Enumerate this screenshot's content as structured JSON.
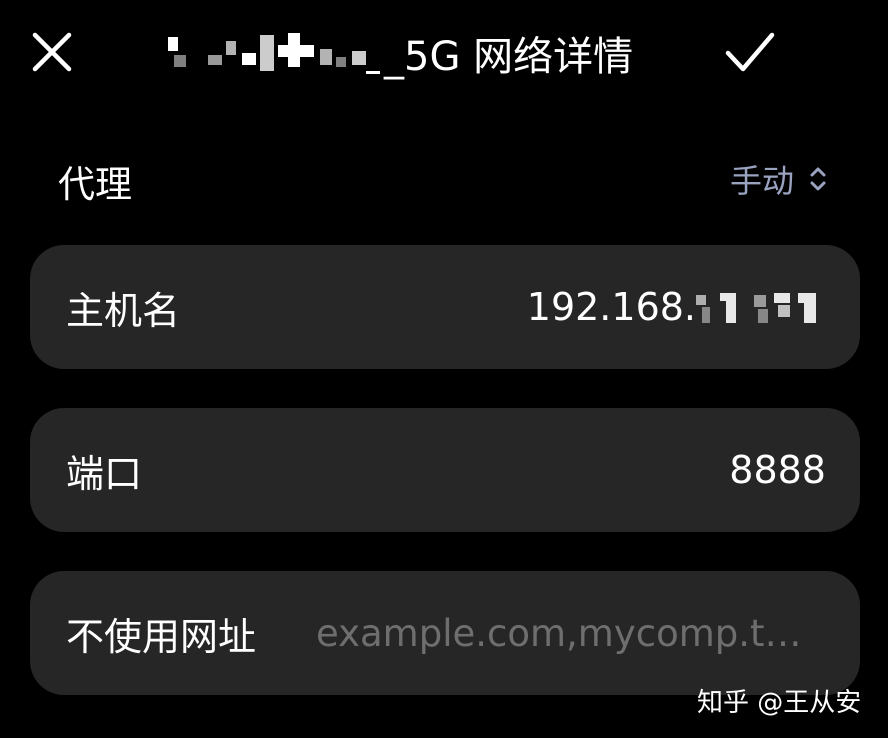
{
  "header": {
    "title_suffix": "_5G 网络详情",
    "close_icon": "close-icon",
    "confirm_icon": "checkmark-icon"
  },
  "proxy": {
    "label": "代理",
    "value": "手动",
    "value_color": "#9aa3c0",
    "value_icon": "chevron-up-down-icon"
  },
  "fields": {
    "hostname": {
      "label": "主机名",
      "value_prefix": "192.168."
    },
    "port": {
      "label": "端口",
      "value": "8888"
    },
    "bypass": {
      "label": "不使用网址",
      "placeholder": "example.com,mycomp.t…"
    }
  },
  "watermark": {
    "text": "知乎 @王从安"
  },
  "colors": {
    "background": "#000000",
    "card": "#262626",
    "placeholder": "#6e6e6e"
  }
}
